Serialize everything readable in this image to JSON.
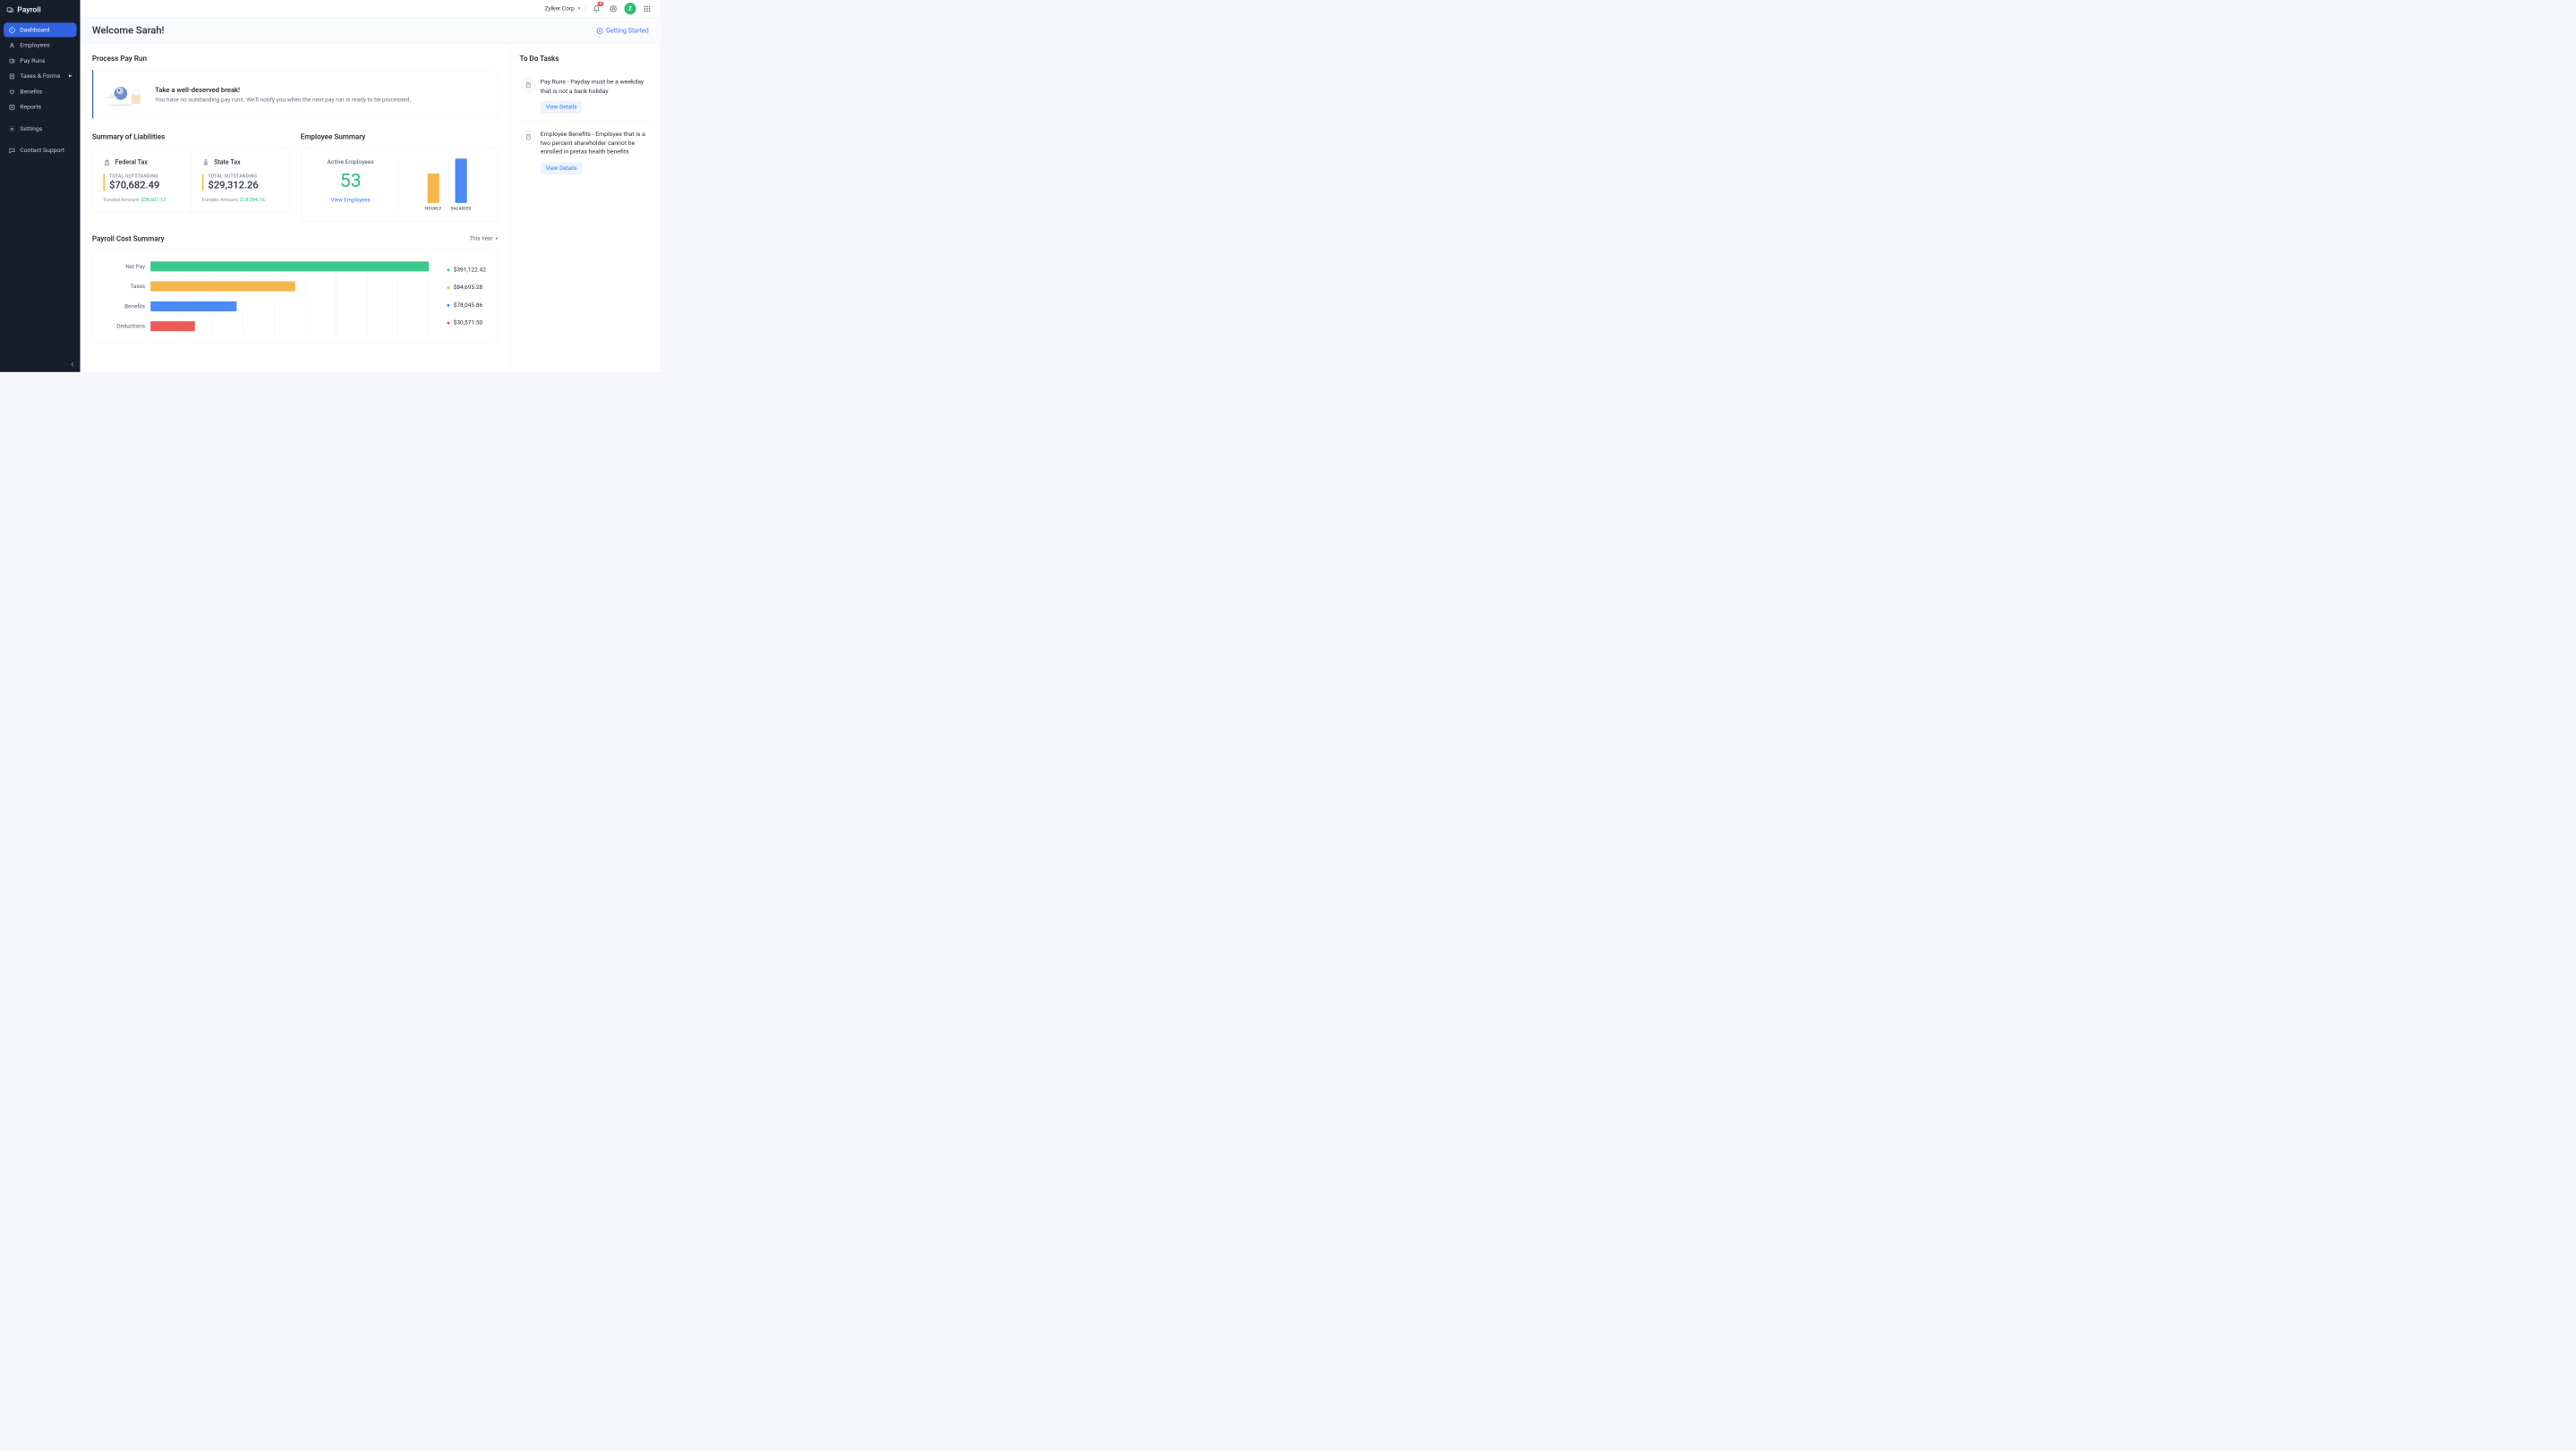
{
  "app_name": "Payroll",
  "sidebar": {
    "items": [
      {
        "label": "Dashboard",
        "active": true
      },
      {
        "label": "Employees"
      },
      {
        "label": "Pay Runs"
      },
      {
        "label": "Taxes & Forms",
        "submenu": true
      },
      {
        "label": "Benefits"
      },
      {
        "label": "Reports"
      },
      {
        "label": "Settings"
      },
      {
        "label": "Contact Support"
      }
    ]
  },
  "topbar": {
    "org_name": "Zylker Corp",
    "notif_count": "4",
    "avatar_letter": "Z"
  },
  "header": {
    "welcome": "Welcome Sarah!",
    "getting_started": "Getting Started"
  },
  "payrun": {
    "section": "Process Pay Run",
    "title": "Take a well-deserved break!",
    "subtitle": "You have no outstanding pay runs. We'll notify you when the next pay run is ready to be processed."
  },
  "liabilities": {
    "section": "Summary of Liabilities",
    "federal": {
      "name": "Federal Tax",
      "out_label": "TOTAL OUTSTANDING",
      "out_value": "$70,682.49",
      "funded_label": "Funded Amount: ",
      "funded_value": "$38,601.12"
    },
    "state": {
      "name": "State Tax",
      "out_label": "TOTAL OUTSTANDING",
      "out_value": "$29,312.26",
      "funded_label": "Funded Amount: ",
      "funded_value": "$18,094.16"
    }
  },
  "employee_summary": {
    "section": "Employee Summary",
    "active_label": "Active Employees",
    "count": "53",
    "link": "View Employees",
    "hourly_label": "HOURLY",
    "salaried_label": "SALARIED"
  },
  "cost": {
    "section": "Payroll Cost Summary",
    "filter": "This Year",
    "rows": [
      {
        "label": "Net Pay",
        "value": "$391,122.42",
        "color": "#3ec98c"
      },
      {
        "label": "Taxes",
        "value": "$84,695.28",
        "color": "#f7b64b"
      },
      {
        "label": "Benefits",
        "value": "$78,045.86",
        "color": "#4c8bf5"
      },
      {
        "label": "Deductions",
        "value": "$30,571.50",
        "color": "#ee5a5a"
      }
    ]
  },
  "chart_data": {
    "type": "bar",
    "orientation": "horizontal",
    "title": "Payroll Cost Summary",
    "categories": [
      "Net Pay",
      "Taxes",
      "Benefits",
      "Deductions"
    ],
    "values": [
      391122.42,
      84695.28,
      78045.86,
      30571.5
    ],
    "colors": [
      "#3ec98c",
      "#f7b64b",
      "#4c8bf5",
      "#ee5a5a"
    ],
    "max": 400000
  },
  "employee_chart": {
    "type": "bar",
    "categories": [
      "HOURLY",
      "SALARIED"
    ],
    "values": [
      35,
      53
    ],
    "colors": [
      "#f7b64b",
      "#4c8bf5"
    ],
    "max": 53
  },
  "todo": {
    "section": "To Do Tasks",
    "tasks": [
      {
        "text": "Pay Runs - Payday must be a weekday that is not a bank holiday",
        "button": "View Details"
      },
      {
        "text": "Employee Benefits - Employee that is a two percent shareholder cannot be enrolled in pretax health benefits",
        "button": "View Details"
      }
    ]
  }
}
